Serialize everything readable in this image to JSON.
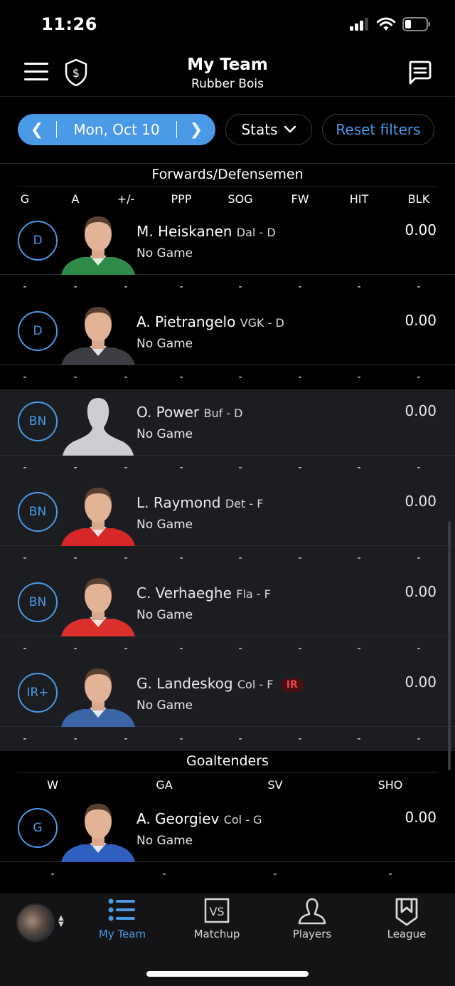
{
  "status_bar": {
    "time": "11:26"
  },
  "header": {
    "title": "My Team",
    "subtitle": "Rubber Bois"
  },
  "filters": {
    "date": "Mon, Oct 10",
    "prev_icon": "chevron-left",
    "next_icon": "chevron-right",
    "stats_label": "Stats",
    "reset_label": "Reset filters"
  },
  "skaters": {
    "title": "Forwards/Defensemen",
    "columns": [
      "G",
      "A",
      "+/-",
      "PPP",
      "SOG",
      "FW",
      "HIT",
      "BLK"
    ],
    "players": [
      {
        "slot": "D",
        "name": "M. Heiskanen",
        "team_pos": "Dal - D",
        "game": "No Game",
        "points": "0.00",
        "stats": [
          "-",
          "-",
          "-",
          "-",
          "-",
          "-",
          "-",
          "-"
        ],
        "status": "",
        "jersey": "#2e8b4a",
        "bench": false
      },
      {
        "slot": "D",
        "name": "A. Pietrangelo",
        "team_pos": "VGK - D",
        "game": "No Game",
        "points": "0.00",
        "stats": [
          "-",
          "-",
          "-",
          "-",
          "-",
          "-",
          "-",
          "-"
        ],
        "status": "",
        "jersey": "#3b3d42",
        "bench": false
      },
      {
        "slot": "BN",
        "name": "O. Power",
        "team_pos": "Buf - D",
        "game": "No Game",
        "points": "0.00",
        "stats": [
          "-",
          "-",
          "-",
          "-",
          "-",
          "-",
          "-",
          "-"
        ],
        "status": "",
        "jersey": "placeholder",
        "bench": true
      },
      {
        "slot": "BN",
        "name": "L. Raymond",
        "team_pos": "Det - F",
        "game": "No Game",
        "points": "0.00",
        "stats": [
          "-",
          "-",
          "-",
          "-",
          "-",
          "-",
          "-",
          "-"
        ],
        "status": "",
        "jersey": "#d62828",
        "bench": true
      },
      {
        "slot": "BN",
        "name": "C. Verhaeghe",
        "team_pos": "Fla - F",
        "game": "No Game",
        "points": "0.00",
        "stats": [
          "-",
          "-",
          "-",
          "-",
          "-",
          "-",
          "-",
          "-"
        ],
        "status": "",
        "jersey": "#d9302c",
        "bench": true
      },
      {
        "slot": "IR+",
        "name": "G. Landeskog",
        "team_pos": "Col - F",
        "game": "No Game",
        "points": "0.00",
        "stats": [
          "-",
          "-",
          "-",
          "-",
          "-",
          "-",
          "-",
          "-"
        ],
        "status": "IR",
        "jersey": "#3a66a8",
        "bench": true
      }
    ]
  },
  "goalies": {
    "title": "Goaltenders",
    "columns": [
      "W",
      "GA",
      "SV",
      "SHO"
    ],
    "players": [
      {
        "slot": "G",
        "name": "A. Georgiev",
        "team_pos": "Col - G",
        "game": "No Game",
        "points": "0.00",
        "stats": [
          "-",
          "-",
          "-",
          "-"
        ],
        "status": "",
        "jersey": "#2f5fbf",
        "bench": false
      }
    ]
  },
  "tabbar": {
    "tabs": [
      {
        "label": "My Team",
        "icon": "list-icon",
        "active": true
      },
      {
        "label": "Matchup",
        "icon": "vs-icon",
        "active": false
      },
      {
        "label": "Players",
        "icon": "person-icon",
        "active": false
      },
      {
        "label": "League",
        "icon": "league-shield-icon",
        "active": false
      }
    ]
  },
  "colors": {
    "accent": "#4a9ae8",
    "ir_badge": "#e5434a",
    "bench_bg": "#1c1d21"
  }
}
